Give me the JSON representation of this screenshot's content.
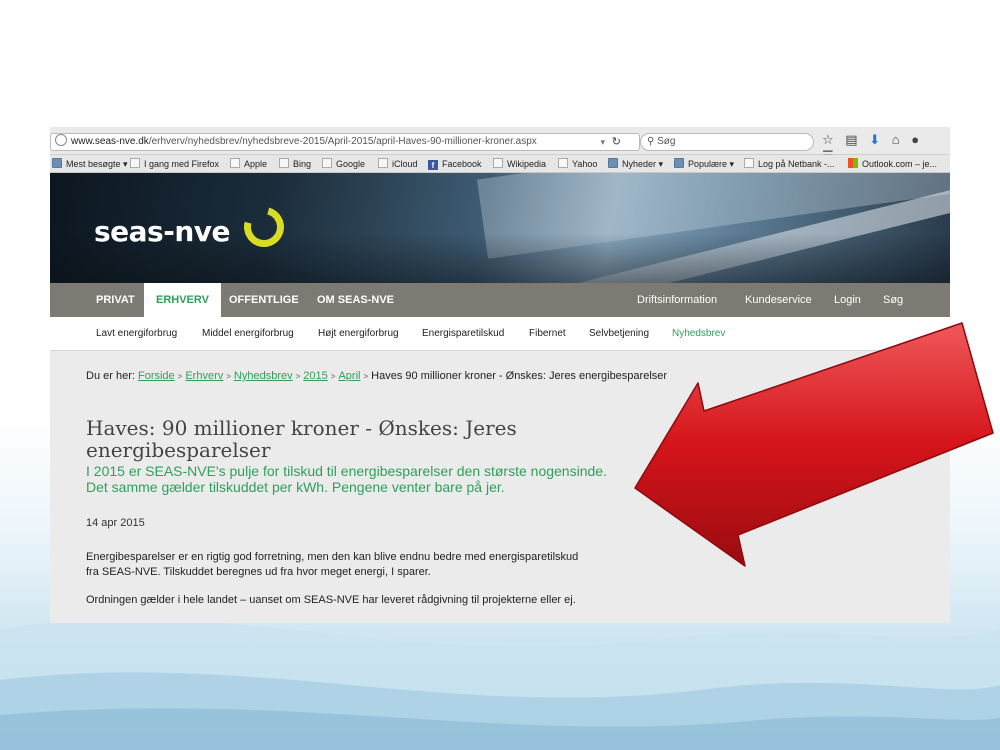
{
  "browser": {
    "url_host": "www.seas-nve.dk",
    "url_path": "/erhverv/nyhedsbrev/nyhedsbreve-2015/April-2015/april-Haves-90-millioner-kroner.aspx",
    "search_placeholder": "Søg",
    "bookmarks": [
      {
        "label": "Mest besøgte ▾",
        "icon": "folder-icon"
      },
      {
        "label": "I gang med Firefox",
        "icon": "page-icon"
      },
      {
        "label": "Apple",
        "icon": "page-icon"
      },
      {
        "label": "Bing",
        "icon": "page-icon"
      },
      {
        "label": "Google",
        "icon": "page-icon"
      },
      {
        "label": "iCloud",
        "icon": "page-icon"
      },
      {
        "label": "Facebook",
        "icon": "facebook-icon"
      },
      {
        "label": "Wikipedia",
        "icon": "page-icon"
      },
      {
        "label": "Yahoo",
        "icon": "page-icon"
      },
      {
        "label": "Nyheder ▾",
        "icon": "folder-icon"
      },
      {
        "label": "Populære ▾",
        "icon": "folder-icon"
      },
      {
        "label": "Log på Netbank -...",
        "icon": "page-icon"
      },
      {
        "label": "Outlook.com – je...",
        "icon": "outlook-icon"
      }
    ]
  },
  "site": {
    "logo_text": "seas-nve",
    "main_nav": [
      "PRIVAT",
      "ERHVERV",
      "OFFENTLIGE",
      "OM SEAS-NVE"
    ],
    "main_nav_active": "ERHVERV",
    "util_nav": [
      "Driftsinformation",
      "Kundeservice",
      "Login",
      "Søg"
    ],
    "sub_nav": [
      "Lavt energiforbrug",
      "Middel energiforbrug",
      "Højt energiforbrug",
      "Energisparetilskud",
      "Fibernet",
      "Selvbetjening",
      "Nyhedsbrev"
    ],
    "sub_nav_active": "Nyhedsbrev"
  },
  "article": {
    "breadcrumb_prefix": "Du er her:",
    "breadcrumb": [
      "Forside",
      "Erhverv",
      "Nyhedsbrev",
      "2015",
      "April"
    ],
    "breadcrumb_current": "Haves 90 millioner kroner - Ønskes: Jeres energibesparelser",
    "title": "Haves: 90 millioner kroner - Ønskes: Jeres energibesparelser",
    "lead": "I 2015 er SEAS-NVE's pulje for tilskud til energibesparelser den største nogensinde. Det samme gælder tilskuddet per kWh. Pengene venter bare på jer.",
    "date": "14 apr 2015",
    "paragraph1": "Energibesparelser er en rigtig god forretning, men den kan blive endnu bedre med energisparetilskud fra SEAS-NVE. Tilskuddet beregnes ud fra hvor meget energi, I sparer.",
    "paragraph2": "Ordningen gælder i hele landet – uanset om SEAS-NVE har leveret rådgivning til projekterne eller ej."
  },
  "colors": {
    "accent_green": "#2f9f5a",
    "nav_gray": "#7d7a73",
    "logo_yellow": "#d8dd24",
    "arrow_red": "#d4141a"
  }
}
